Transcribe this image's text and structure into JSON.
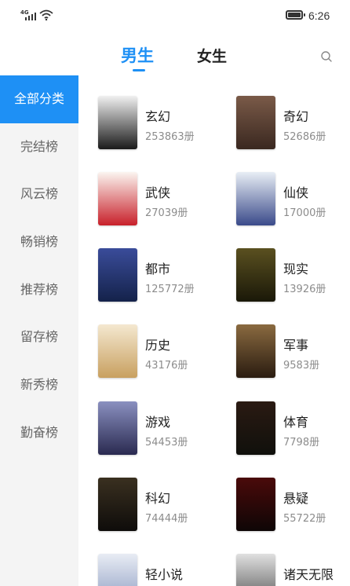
{
  "status_bar": {
    "network": "4G",
    "time": "6:26"
  },
  "tabs": {
    "male": "男生",
    "female": "女生",
    "active": "male"
  },
  "sidebar": {
    "items": [
      {
        "label": "全部分类",
        "active": true
      },
      {
        "label": "完结榜"
      },
      {
        "label": "风云榜"
      },
      {
        "label": "畅销榜"
      },
      {
        "label": "推荐榜"
      },
      {
        "label": "留存榜"
      },
      {
        "label": "新秀榜"
      },
      {
        "label": "勤奋榜"
      }
    ]
  },
  "categories": [
    {
      "name": "玄幻",
      "count": "253863册",
      "cover_colors": [
        "#f1f1f1",
        "#1a1a1a"
      ]
    },
    {
      "name": "奇幻",
      "count": "52686册",
      "cover_colors": [
        "#7a5a48",
        "#3a2820"
      ]
    },
    {
      "name": "武侠",
      "count": "27039册",
      "cover_colors": [
        "#fbf5f0",
        "#c8202a"
      ]
    },
    {
      "name": "仙侠",
      "count": "17000册",
      "cover_colors": [
        "#e8eef5",
        "#3a4a8a"
      ]
    },
    {
      "name": "都市",
      "count": "125772册",
      "cover_colors": [
        "#3a4c9a",
        "#14224a"
      ]
    },
    {
      "name": "现实",
      "count": "13926册",
      "cover_colors": [
        "#5a5020",
        "#1a1808"
      ]
    },
    {
      "name": "历史",
      "count": "43176册",
      "cover_colors": [
        "#f4e8d0",
        "#c8a060"
      ]
    },
    {
      "name": "军事",
      "count": "9583册",
      "cover_colors": [
        "#8a6a40",
        "#2a1c10"
      ]
    },
    {
      "name": "游戏",
      "count": "54453册",
      "cover_colors": [
        "#8a90c0",
        "#2a2a50"
      ]
    },
    {
      "name": "体育",
      "count": "7798册",
      "cover_colors": [
        "#2a1a12",
        "#10100c"
      ]
    },
    {
      "name": "科幻",
      "count": "74444册",
      "cover_colors": [
        "#3a3020",
        "#0e0c0a"
      ]
    },
    {
      "name": "悬疑",
      "count": "55722册",
      "cover_colors": [
        "#4a0a0a",
        "#0e0606"
      ]
    },
    {
      "name": "轻小说",
      "count": "",
      "cover_colors": [
        "#e8ecf4",
        "#8a9ac0"
      ]
    },
    {
      "name": "诸天无限",
      "count": "",
      "cover_colors": [
        "#e0e0e0",
        "#505050"
      ]
    }
  ],
  "accent_color": "#1e90f5"
}
